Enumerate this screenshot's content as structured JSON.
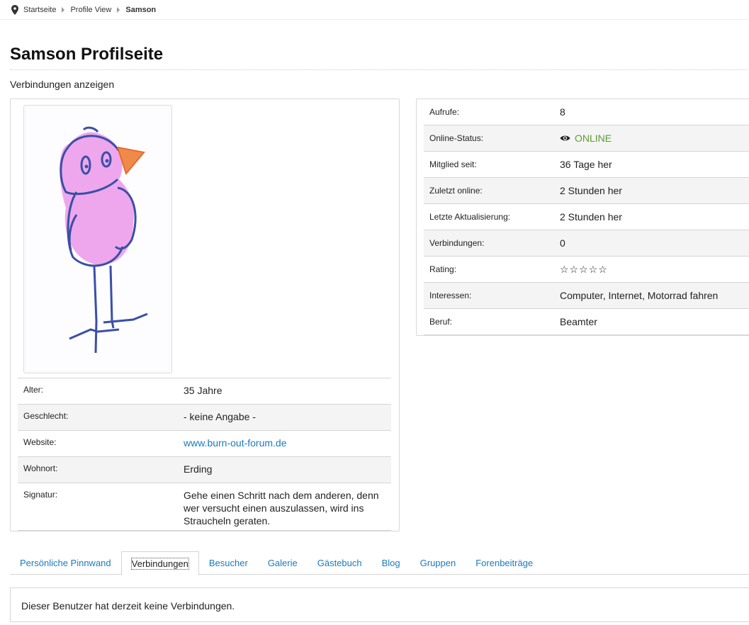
{
  "breadcrumb": {
    "items": [
      "Startseite",
      "Profile View"
    ],
    "current": "Samson"
  },
  "page": {
    "title": "Samson Profilseite",
    "connections_link": "Verbindungen anzeigen"
  },
  "profile_info": [
    {
      "label": "Alter:",
      "value": "35 Jahre"
    },
    {
      "label": "Geschlecht:",
      "value": "- keine Angabe -"
    },
    {
      "label": "Website:",
      "value": "www.burn-out-forum.de"
    },
    {
      "label": "Wohnort:",
      "value": "Erding"
    },
    {
      "label": "Signatur:",
      "value": "Gehe einen Schritt nach dem anderen, denn wer versucht einen auszulassen, wird ins Straucheln geraten."
    }
  ],
  "stats": [
    {
      "label": "Aufrufe:",
      "value": "8"
    },
    {
      "label": "Online-Status:",
      "value": "ONLINE"
    },
    {
      "label": "Mitglied seit:",
      "value": "36 Tage her"
    },
    {
      "label": "Zuletzt online:",
      "value": "2 Stunden her"
    },
    {
      "label": "Letzte Aktualisierung:",
      "value": "2 Stunden her"
    },
    {
      "label": "Verbindungen:",
      "value": "0"
    },
    {
      "label": "Rating:",
      "value": "☆☆☆☆☆"
    },
    {
      "label": "Interessen:",
      "value": "Computer, Internet, Motorrad fahren"
    },
    {
      "label": "Beruf:",
      "value": "Beamter"
    }
  ],
  "tabs": [
    {
      "label": "Persönliche Pinnwand",
      "active": false
    },
    {
      "label": "Verbindungen",
      "active": true
    },
    {
      "label": "Besucher",
      "active": false
    },
    {
      "label": "Galerie",
      "active": false
    },
    {
      "label": "Gästebuch",
      "active": false
    },
    {
      "label": "Blog",
      "active": false
    },
    {
      "label": "Gruppen",
      "active": false
    },
    {
      "label": "Forenbeiträge",
      "active": false
    }
  ],
  "content": {
    "message": "Dieser Benutzer hat derzeit keine Verbindungen."
  },
  "icons": {
    "breadcrumb": "map-pin-icon",
    "online": "eye-icon"
  },
  "colors": {
    "link": "#1a7bbd",
    "online": "#5a9e2f"
  }
}
